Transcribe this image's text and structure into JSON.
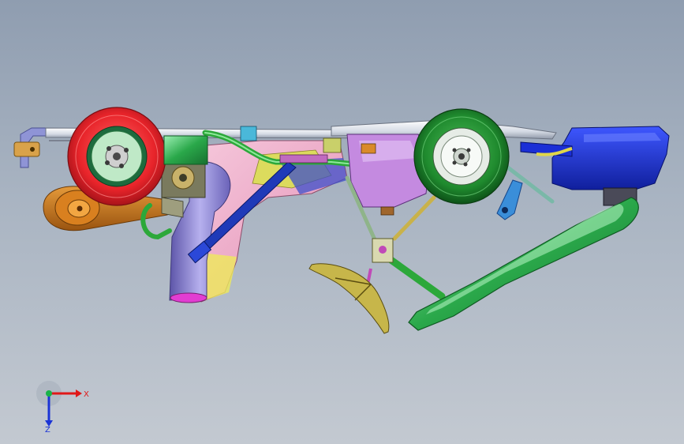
{
  "viewport": {
    "background_top": "#8f9db0",
    "background_bottom": "#c3c9d1"
  },
  "model": {
    "parts": [
      {
        "name": "rear-wheel",
        "color": "#e8242a"
      },
      {
        "name": "front-wheel",
        "color": "#1f8a2e"
      },
      {
        "name": "seat",
        "color": "#2aa84a"
      },
      {
        "name": "front-bumper",
        "color": "#1b2fd6"
      },
      {
        "name": "fuel-tank",
        "color": "#b56fcf"
      },
      {
        "name": "exhaust-pipe",
        "color": "#7e74c9"
      },
      {
        "name": "steering-wheel",
        "color": "#c7b64a"
      },
      {
        "name": "chain-guard",
        "color": "#b86a12"
      },
      {
        "name": "push-rod",
        "color": "#1f3ab8"
      }
    ]
  },
  "triad": {
    "x_label": "X",
    "z_label": "Z",
    "x_color": "#e01818",
    "y_color": "#19b34a",
    "z_color": "#1b34d6"
  }
}
